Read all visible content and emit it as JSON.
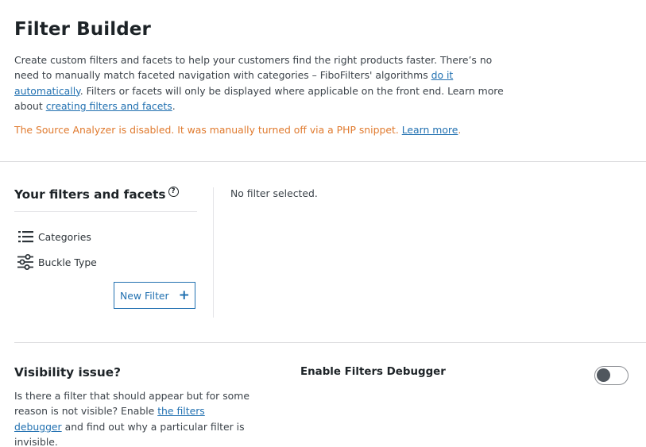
{
  "header": {
    "title": "Filter Builder",
    "intro_part1": "Create custom filters and facets to help your customers find the right products faster. There’s no need to manually match faceted navigation with categories – FiboFilters' algorithms ",
    "intro_link1": "do it automatically",
    "intro_part2": ". Filters or facets will only be displayed where applicable on the front end. Learn more about ",
    "intro_link2": "creating filters and facets",
    "intro_part3": ".",
    "warning_text": "The Source Analyzer is disabled. It was manually turned off via a PHP snippet. ",
    "warning_link": "Learn more",
    "warning_end": "."
  },
  "filters_panel": {
    "title": "Your filters and facets",
    "help_icon": "?",
    "items": [
      {
        "label": "Categories",
        "icon": "list-icon"
      },
      {
        "label": "Buckle Type",
        "icon": "sliders-icon"
      }
    ],
    "new_filter_label": "New Filter",
    "new_filter_icon": "+"
  },
  "detail_panel": {
    "empty_text": "No filter selected."
  },
  "visibility": {
    "title": "Visibility issue?",
    "text_part1": "Is there a filter that should appear but for some reason is not visible? Enable ",
    "text_link": "the filters debugger",
    "text_part2": " and find out why a particular filter is invisible.",
    "debugger_label": "Enable Filters Debugger",
    "debugger_enabled": false
  },
  "colors": {
    "link": "#2271b1",
    "warning": "#e07a2e",
    "text": "#3c434a",
    "heading": "#1d2327"
  }
}
